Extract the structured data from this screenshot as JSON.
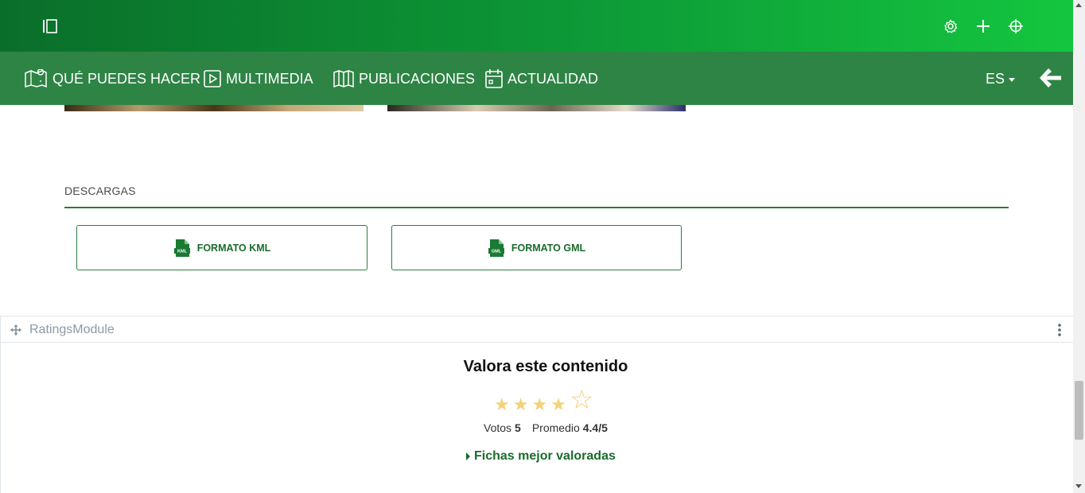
{
  "topbar": {
    "icons": [
      "sidebar-toggle-icon",
      "gear-icon",
      "plus-icon",
      "crosshair-icon"
    ]
  },
  "nav": {
    "items": [
      {
        "label": "QUÉ PUEDES HACER",
        "icon": "map-pin-icon"
      },
      {
        "label": "MULTIMEDIA",
        "icon": "play-icon"
      },
      {
        "label": "PUBLICACIONES",
        "icon": "book-icon"
      },
      {
        "label": "ACTUALIDAD",
        "icon": "calendar-icon"
      }
    ],
    "language": "ES",
    "back_icon": "arrow-left-icon"
  },
  "downloads": {
    "title": "DESCARGAS",
    "buttons": [
      {
        "label": "FORMATO KML",
        "icon_text": "KML"
      },
      {
        "label": "FORMATO GML",
        "icon_text": "GML"
      }
    ]
  },
  "ratings_module": {
    "module_name": "RatingsModule",
    "title": "Valora este contenido",
    "stars_filled": 4,
    "stars_total": 5,
    "votes_label": "Votos",
    "votes_value": "5",
    "average_label": "Promedio",
    "average_value": "4.4/5",
    "top_rated_link": "Fichas mejor valoradas"
  },
  "colors": {
    "topbar_start": "#0a6e2a",
    "topbar_end": "#14c63f",
    "navbar": "#2e8444",
    "accent_green": "#1a6b2c",
    "star": "#f3d27a"
  }
}
